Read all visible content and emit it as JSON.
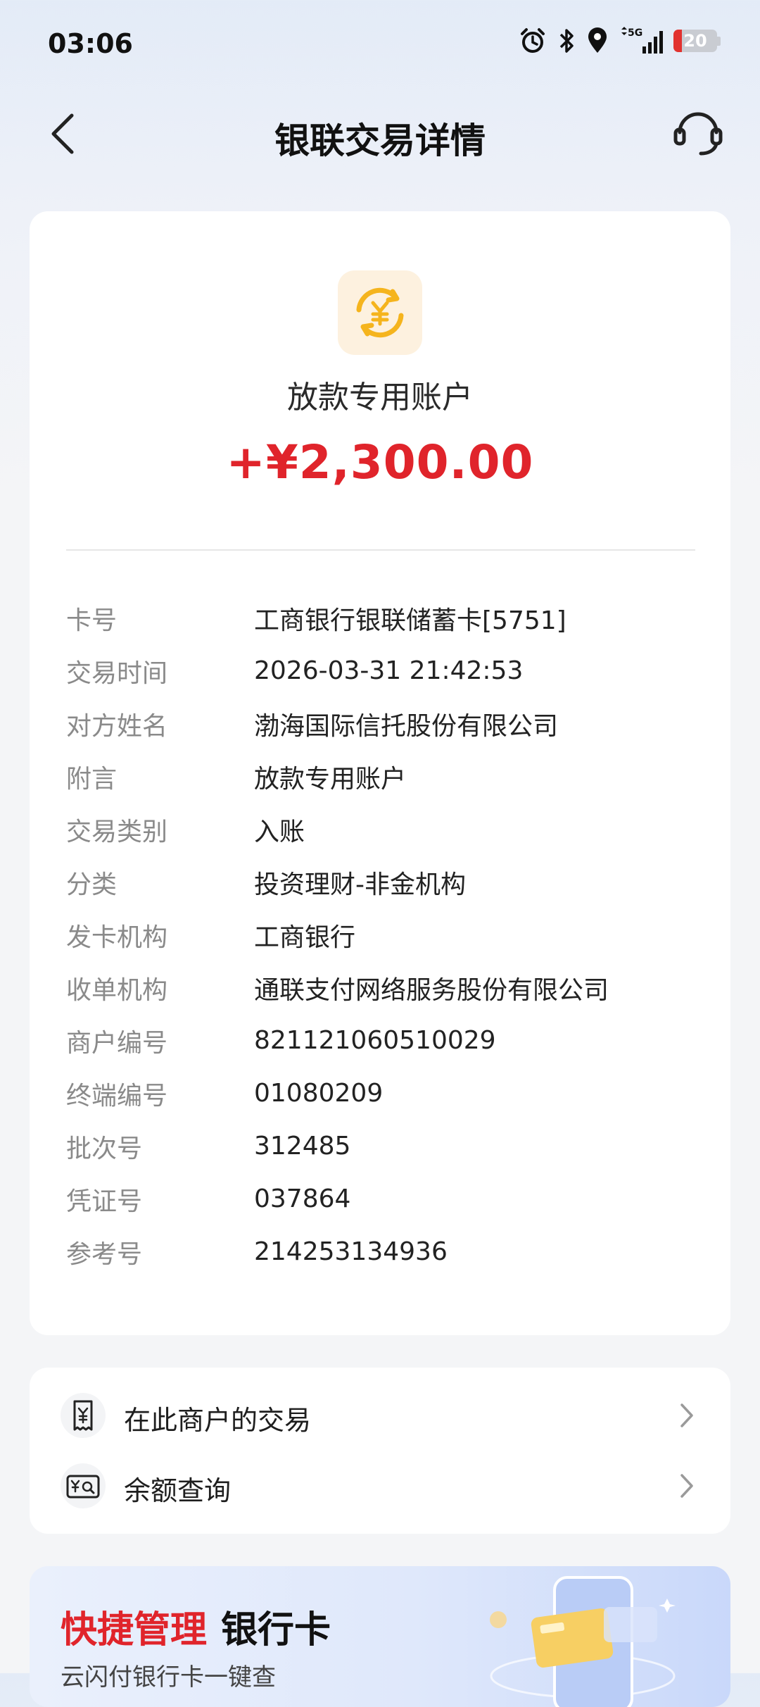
{
  "status_bar": {
    "time": "03:06",
    "icons": [
      "alarm-icon",
      "bluetooth-icon",
      "location-icon",
      "5g-signal-icon",
      "battery-icon"
    ],
    "network": "5G",
    "battery_level": "20",
    "battery_color": "#e2322f"
  },
  "header": {
    "title": "银联交易详情",
    "back_icon": "back-arrow-icon",
    "service_icon": "customer-service-icon"
  },
  "transaction": {
    "icon": "yuan-exchange-icon",
    "account_name": "放款专用账户",
    "amount": "+¥2,300.00",
    "amount_color": "#e0242b",
    "details": [
      {
        "label": "卡号",
        "value": "工商银行银联储蓄卡[5751]"
      },
      {
        "label": "交易时间",
        "value": "2026-03-31 21:42:53"
      },
      {
        "label": "对方姓名",
        "value": "渤海国际信托股份有限公司"
      },
      {
        "label": "附言",
        "value": "放款专用账户"
      },
      {
        "label": "交易类别",
        "value": "入账"
      },
      {
        "label": "分类",
        "value": "投资理财-非金机构"
      },
      {
        "label": "发卡机构",
        "value": "工商银行"
      },
      {
        "label": "收单机构",
        "value": "通联支付网络服务股份有限公司"
      },
      {
        "label": "商户编号",
        "value": "821121060510029"
      },
      {
        "label": "终端编号",
        "value": "01080209"
      },
      {
        "label": "批次号",
        "value": "312485"
      },
      {
        "label": "凭证号",
        "value": "037864"
      },
      {
        "label": "参考号",
        "value": "214253134936"
      }
    ]
  },
  "actions": [
    {
      "label": "在此商户的交易",
      "icon": "receipt-icon"
    },
    {
      "label": "余额查询",
      "icon": "balance-search-icon"
    }
  ],
  "banner": {
    "title_highlight": "快捷管理",
    "title_rest": "银行卡",
    "subtitle": "云闪付银行卡一键查"
  }
}
